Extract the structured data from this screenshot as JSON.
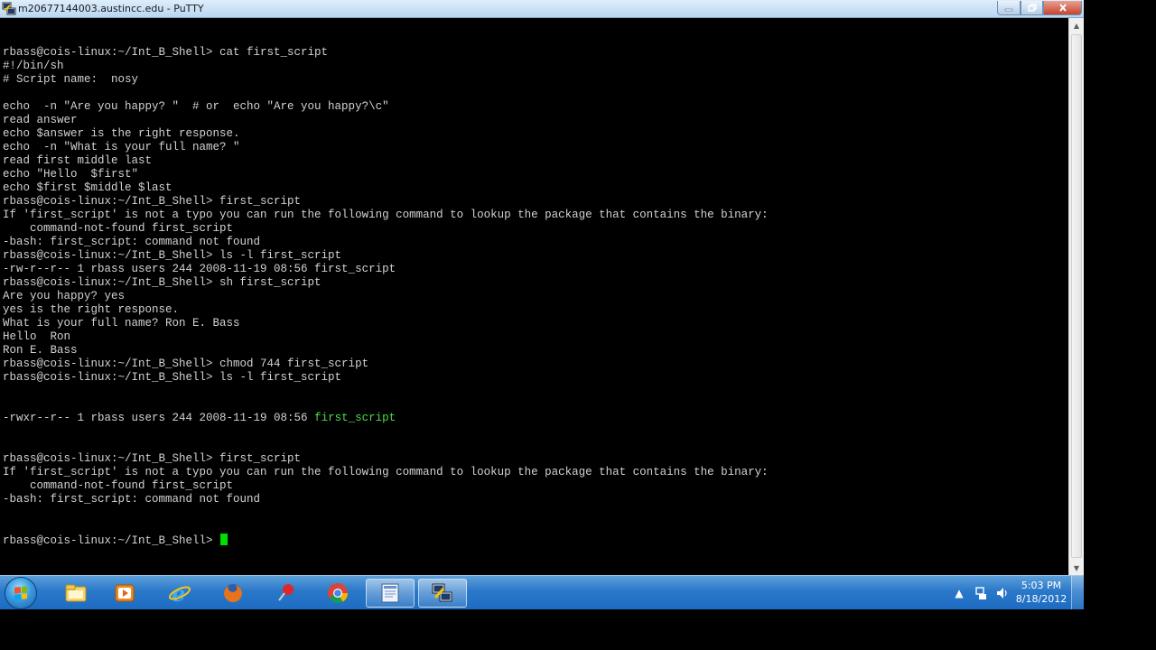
{
  "window": {
    "title": "m20677144003.austincc.edu - PuTTY",
    "icon": "putty-icon",
    "buttons": {
      "minimize_icon": "minimize-icon",
      "maximize_icon": "maximize-icon",
      "close_icon": "close-icon"
    }
  },
  "terminal": {
    "text_color": "#d2d2d2",
    "background": "#000000",
    "highlight_color": "#4cdb4c",
    "cursor_color": "#00e000",
    "lines": [
      "rbass@cois-linux:~/Int_B_Shell> cat first_script",
      "#!/bin/sh",
      "# Script name:  nosy",
      "",
      "echo  -n \"Are you happy? \"  # or  echo \"Are you happy?\\c\"",
      "read answer",
      "echo $answer is the right response.",
      "echo  -n \"What is your full name? \"",
      "read first middle last",
      "echo \"Hello  $first\"",
      "echo $first $middle $last",
      "rbass@cois-linux:~/Int_B_Shell> first_script",
      "If 'first_script' is not a typo you can run the following command to lookup the package that contains the binary:",
      "    command-not-found first_script",
      "-bash: first_script: command not found",
      "rbass@cois-linux:~/Int_B_Shell> ls -l first_script",
      "-rw-r--r-- 1 rbass users 244 2008-11-19 08:56 first_script",
      "rbass@cois-linux:~/Int_B_Shell> sh first_script",
      "Are you happy? yes",
      "yes is the right response.",
      "What is your full name? Ron E. Bass",
      "Hello  Ron",
      "Ron E. Bass",
      "rbass@cois-linux:~/Int_B_Shell> chmod 744 first_script",
      "rbass@cois-linux:~/Int_B_Shell> ls -l first_script"
    ],
    "ls_line_prefix": "-rwxr--r-- 1 rbass users 244 2008-11-19 08:56 ",
    "ls_line_file": "first_script",
    "lines_after": [
      "rbass@cois-linux:~/Int_B_Shell> first_script",
      "If 'first_script' is not a typo you can run the following command to lookup the package that contains the binary:",
      "    command-not-found first_script",
      "-bash: first_script: command not found"
    ],
    "prompt": "rbass@cois-linux:~/Int_B_Shell> "
  },
  "taskbar": {
    "start_icon": "windows-start-orb-icon",
    "pinned": [
      {
        "name": "windows-explorer-icon"
      },
      {
        "name": "media-player-icon"
      },
      {
        "name": "internet-explorer-icon"
      },
      {
        "name": "firefox-icon"
      },
      {
        "name": "pushpin-app-icon"
      },
      {
        "name": "chrome-icon"
      },
      {
        "name": "document-app-icon"
      },
      {
        "name": "putty-taskbar-icon",
        "active": true
      }
    ],
    "tray_icons": [
      "show-hidden-icons-chevron-icon",
      "network-icon",
      "volume-icon"
    ],
    "clock": {
      "time": "5:03 PM",
      "date": "8/18/2012"
    }
  }
}
